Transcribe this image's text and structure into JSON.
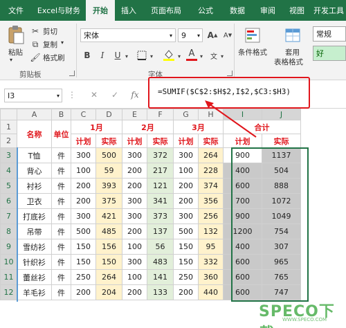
{
  "tabs": [
    "文件",
    "Excel与财务",
    "开始",
    "插入",
    "页面布局",
    "公式",
    "数据",
    "审阅",
    "视图",
    "开发工具"
  ],
  "active_tab": "开始",
  "ribbon": {
    "paste": "粘贴",
    "cut": "剪切",
    "copy": "复制",
    "format_painter": "格式刷",
    "clipboard_group": "剪贴板",
    "font_name": "宋体",
    "font_size": "9",
    "font_group": "字体",
    "bold": "B",
    "italic": "I",
    "underline": "U",
    "font_color_letter": "A",
    "cond_format": "条件格式",
    "apply_table": "套用",
    "table_format": "表格格式",
    "style_normal": "常规",
    "style_good": "好",
    "accent_colors": {
      "font_color_bar": "#e0161c",
      "fill_bar": "#ffff00"
    }
  },
  "formula_bar": {
    "name_box": "I3",
    "fx": "fx",
    "formula": "=SUMIF($C$2:$H$2,I$2,$C3:$H3)"
  },
  "sheet": {
    "columns": [
      "A",
      "B",
      "C",
      "D",
      "E",
      "F",
      "G",
      "H",
      "I",
      "J"
    ],
    "row_numbers": [
      "1",
      "2",
      "3",
      "4",
      "5",
      "6",
      "7",
      "8",
      "9",
      "10",
      "11",
      "12"
    ],
    "header": {
      "name": "名称",
      "unit": "单位",
      "month1": "1月",
      "month2": "2月",
      "month3": "3月",
      "total": "合计",
      "plan": "计划",
      "actual": "实际"
    },
    "rows": [
      {
        "name": "T恤",
        "unit": "件",
        "v": [
          "300",
          "500",
          "300",
          "372",
          "300",
          "264"
        ],
        "sum_plan": "900",
        "sum_actual": "1137"
      },
      {
        "name": "背心",
        "unit": "件",
        "v": [
          "100",
          "59",
          "200",
          "217",
          "100",
          "228"
        ],
        "sum_plan": "400",
        "sum_actual": "504"
      },
      {
        "name": "衬衫",
        "unit": "件",
        "v": [
          "200",
          "393",
          "200",
          "121",
          "200",
          "374"
        ],
        "sum_plan": "600",
        "sum_actual": "888"
      },
      {
        "name": "卫衣",
        "unit": "件",
        "v": [
          "200",
          "375",
          "300",
          "341",
          "200",
          "356"
        ],
        "sum_plan": "700",
        "sum_actual": "1072"
      },
      {
        "name": "打底衫",
        "unit": "件",
        "v": [
          "300",
          "421",
          "300",
          "373",
          "300",
          "256"
        ],
        "sum_plan": "900",
        "sum_actual": "1049"
      },
      {
        "name": "吊带",
        "unit": "件",
        "v": [
          "500",
          "485",
          "200",
          "137",
          "500",
          "132"
        ],
        "sum_plan": "1200",
        "sum_actual": "754"
      },
      {
        "name": "雪纺衫",
        "unit": "件",
        "v": [
          "150",
          "156",
          "100",
          "56",
          "150",
          "95"
        ],
        "sum_plan": "400",
        "sum_actual": "307"
      },
      {
        "name": "针织衫",
        "unit": "件",
        "v": [
          "150",
          "150",
          "300",
          "483",
          "150",
          "332"
        ],
        "sum_plan": "600",
        "sum_actual": "965"
      },
      {
        "name": "蕾丝衫",
        "unit": "件",
        "v": [
          "250",
          "264",
          "100",
          "141",
          "250",
          "360"
        ],
        "sum_plan": "600",
        "sum_actual": "765"
      },
      {
        "name": "羊毛衫",
        "unit": "件",
        "v": [
          "200",
          "204",
          "200",
          "133",
          "200",
          "440"
        ],
        "sum_plan": "600",
        "sum_actual": "747"
      }
    ]
  },
  "watermark": {
    "main": "SPECO下载",
    "sub": "WWW.SPECO.COM"
  }
}
